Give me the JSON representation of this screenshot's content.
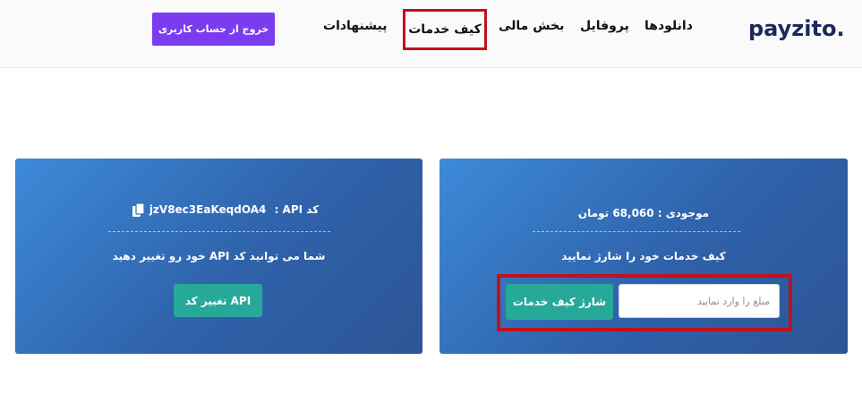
{
  "header": {
    "logo_text": "payzito.",
    "nav": {
      "downloads": "دانلودها",
      "profile": "پروفایل",
      "finance": "بخش مالی",
      "wallet": "کیف خدمات",
      "suggestions": "پیشنهادات"
    },
    "logout_label": "خروج از حساب کاربری"
  },
  "api_card": {
    "api_label": "کد API :",
    "api_code": "jzV8ec3EaKeqdOA4",
    "description": "شما می توانید کد API خود رو تغییر دهید",
    "change_button": "تغییر کد API"
  },
  "wallet_card": {
    "balance_text": "موجودی : 68,060 تومان",
    "description": "کیف خدمات خود را شارژ نمایید",
    "amount_placeholder": "مبلغ را وارد نمایید",
    "charge_button": "شارژ کیف خدمات"
  },
  "colors": {
    "accent_purple": "#7b3cf0",
    "button_teal": "#27a99a",
    "highlight_red": "#c0121a",
    "logo_navy": "#1b2a5c"
  }
}
